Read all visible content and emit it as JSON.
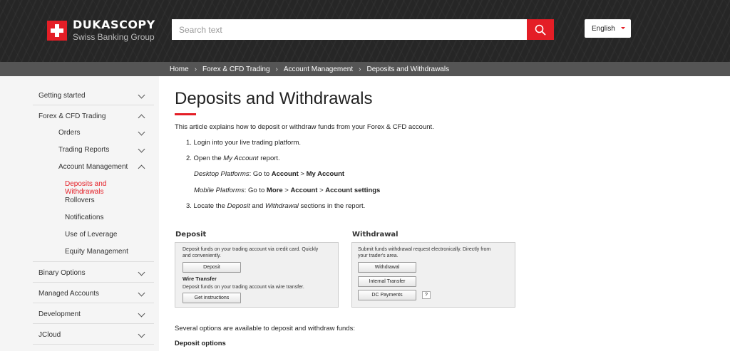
{
  "header": {
    "logo_name": "DUKASCOPY",
    "logo_sub": "Swiss Banking Group",
    "search_placeholder": "Search text",
    "language": "English"
  },
  "breadcrumb": [
    "Home",
    "Forex & CFD Trading",
    "Account Management",
    "Deposits and Withdrawals"
  ],
  "sidebar": {
    "items": [
      {
        "label": "Getting started",
        "level": 0,
        "chevron": "down"
      },
      {
        "label": "Forex & CFD Trading",
        "level": 0,
        "chevron": "up"
      },
      {
        "label": "Orders",
        "level": 1,
        "chevron": "down"
      },
      {
        "label": "Trading Reports",
        "level": 1,
        "chevron": "down"
      },
      {
        "label": "Account Management",
        "level": 1,
        "chevron": "up"
      },
      {
        "label": "Deposits and Withdrawals",
        "level": 2,
        "active": true
      },
      {
        "label": "Rollovers",
        "level": 2
      },
      {
        "label": "Notifications",
        "level": 2
      },
      {
        "label": "Use of Leverage",
        "level": 2
      },
      {
        "label": "Equity Management",
        "level": 2
      },
      {
        "label": "Binary Options",
        "level": 0,
        "chevron": "down"
      },
      {
        "label": "Managed Accounts",
        "level": 0,
        "chevron": "down"
      },
      {
        "label": "Development",
        "level": 0,
        "chevron": "down"
      },
      {
        "label": "JCloud",
        "level": 0,
        "chevron": "down"
      }
    ]
  },
  "article": {
    "title": "Deposits and Withdrawals",
    "intro": "This article explains how to deposit or withdraw funds from your Forex & CFD account.",
    "step1": "1. Login into your live trading platform.",
    "step2_prefix": "2. Open the ",
    "step2_italic": "My Account",
    "step2_suffix": " report.",
    "desktop_label": "Desktop Platforms",
    "desktop_text": ": Go to ",
    "desktop_b1": "Account",
    "desktop_gt": " > ",
    "desktop_b2": "My Account",
    "mobile_label": "Mobile Platforms",
    "mobile_text": ": Go to ",
    "mobile_b1": "More",
    "mobile_gt1": " > ",
    "mobile_b2": "Account",
    "mobile_gt2": " > ",
    "mobile_b3": "Account settings",
    "step3_prefix": "3. Locate the ",
    "step3_i1": "Deposit",
    "step3_and": " and ",
    "step3_i2": "Withdrawal",
    "step3_suffix": " sections in the report.",
    "options_text": "Several options are available to deposit and withdraw funds:",
    "deposit_options_heading": "Deposit options"
  },
  "widget": {
    "deposit_title": "Deposit",
    "deposit_desc_1": "Deposit funds on your trading account via credit card. Quickly",
    "deposit_desc_2": "and conveniently.",
    "deposit_button": "Deposit",
    "wire_title": "Wire Transfer",
    "wire_desc": "Deposit funds on your trading account via wire transfer.",
    "wire_button": "Get instructions",
    "withdrawal_title": "Withdrawal",
    "withdrawal_desc_1": "Submit funds withdrawal request electronically. Directly from",
    "withdrawal_desc_2": "your trader's area.",
    "withdrawal_button": "Withdrawal",
    "internal_button": "Internal Transfer",
    "dc_button": "DC Payments",
    "help_button": "?"
  },
  "colors": {
    "accent": "#e41e26",
    "header_bg": "#262626",
    "crumb_bg": "#555555",
    "sidebar_bg": "#f5f5f5"
  }
}
